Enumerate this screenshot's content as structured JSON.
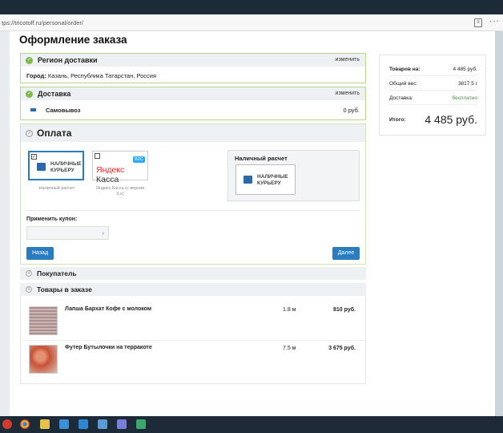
{
  "browser": {
    "url": "tps://tricotoff.ru/personal/order/",
    "more": "···"
  },
  "page": {
    "title": "Оформление заказа"
  },
  "region": {
    "label": "Регион доставки",
    "change": "изменить",
    "city_key": "Город:",
    "city_value": "Казань, Республика Татарстан, Россия"
  },
  "delivery": {
    "label": "Доставка",
    "change": "изменить",
    "method": "Самовывоз",
    "price": "0 руб."
  },
  "payment": {
    "label": "Оплата",
    "options": [
      {
        "title_line1": "НАЛИЧНЫЕ",
        "title_line2": "КУРЬЕРУ",
        "caption": "Наличный расчет",
        "selected": true
      },
      {
        "logo_a": "Яндекс",
        "logo_b": "Касса",
        "badge": "B2C",
        "caption_line1": "Яндекс.Касса (с версии",
        "caption_line2": "3.х)",
        "selected": false
      }
    ],
    "selected_title": "Наличный расчет",
    "selected_card_line1": "НАЛИЧНЫЕ",
    "selected_card_line2": "КУРЬЕРУ",
    "coupon_label": "Применить купон:",
    "back": "Назад",
    "next": "Далее"
  },
  "buyer": {
    "label": "Покупатель"
  },
  "cart": {
    "label": "Товары в заказе",
    "items": [
      {
        "name": "Лапша Бархат Кофе с молоком",
        "qty": "1.8 м",
        "sum": "810 руб."
      },
      {
        "name": "Футер Бутылочки на терракоте",
        "qty": "7.5 м",
        "sum": "3 675 руб."
      }
    ]
  },
  "summary": {
    "goods_key": "Товаров на:",
    "goods_val": "4 485 руб.",
    "weight_key": "Общий вес:",
    "weight_val": "3817.5 г",
    "delivery_key": "Доставка:",
    "delivery_val": "бесплатно",
    "total_key": "Итого:",
    "total_val": "4 485 руб."
  },
  "colors": {
    "accent": "#2b7bbf",
    "green": "#7fb94e",
    "free": "#3a9a2e"
  }
}
